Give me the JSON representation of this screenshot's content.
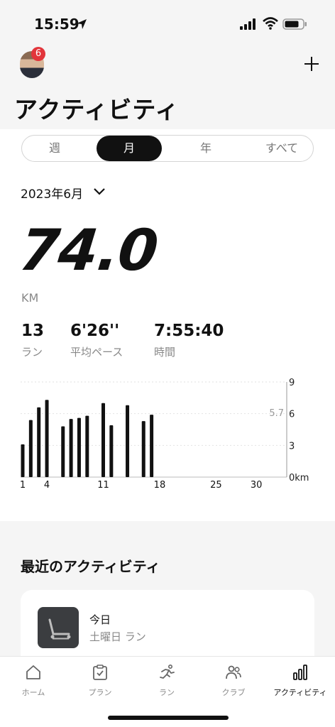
{
  "status_bar": {
    "time": "15:59"
  },
  "header": {
    "notification_count": "6",
    "title": "アクティビティ"
  },
  "period_tabs": [
    {
      "label": "週",
      "active": false
    },
    {
      "label": "月",
      "active": true
    },
    {
      "label": "年",
      "active": false
    },
    {
      "label": "すべて",
      "active": false
    }
  ],
  "month_selector": {
    "label": "2023年6月"
  },
  "summary": {
    "distance": "74.0",
    "distance_unit": "KM",
    "stats": [
      {
        "value": "13",
        "label": "ラン"
      },
      {
        "value": "6'26''",
        "label": "平均ペース"
      },
      {
        "value": "7:55:40",
        "label": "時間"
      }
    ]
  },
  "chart_data": {
    "type": "bar",
    "x_ticks": [
      "1",
      "4",
      "11",
      "18",
      "25",
      "30"
    ],
    "y_ticks": [
      "9",
      "6",
      "3",
      "0km"
    ],
    "ylim": [
      0,
      9
    ],
    "average_line": {
      "value": 5.7,
      "label": "5.7"
    },
    "bars": [
      {
        "day": 1,
        "value": 3.1
      },
      {
        "day": 2,
        "value": 5.4
      },
      {
        "day": 3,
        "value": 6.6
      },
      {
        "day": 4,
        "value": 7.3
      },
      {
        "day": 6,
        "value": 4.8
      },
      {
        "day": 7,
        "value": 5.5
      },
      {
        "day": 8,
        "value": 5.6
      },
      {
        "day": 9,
        "value": 5.8
      },
      {
        "day": 11,
        "value": 7.0
      },
      {
        "day": 12,
        "value": 4.9
      },
      {
        "day": 14,
        "value": 6.8
      },
      {
        "day": 16,
        "value": 5.3
      },
      {
        "day": 17,
        "value": 5.9
      }
    ]
  },
  "recent": {
    "title": "最近のアクティビティ",
    "items": [
      {
        "day": "今日",
        "subtitle": "土曜日 ラン",
        "icon": "treadmill-icon"
      }
    ]
  },
  "tabbar": [
    {
      "label": "ホーム",
      "icon": "home-icon",
      "active": false
    },
    {
      "label": "プラン",
      "icon": "clipboard-icon",
      "active": false
    },
    {
      "label": "ラン",
      "icon": "runner-icon",
      "active": false
    },
    {
      "label": "クラブ",
      "icon": "people-icon",
      "active": false
    },
    {
      "label": "アクティビティ",
      "icon": "bar-chart-icon",
      "active": true
    }
  ]
}
